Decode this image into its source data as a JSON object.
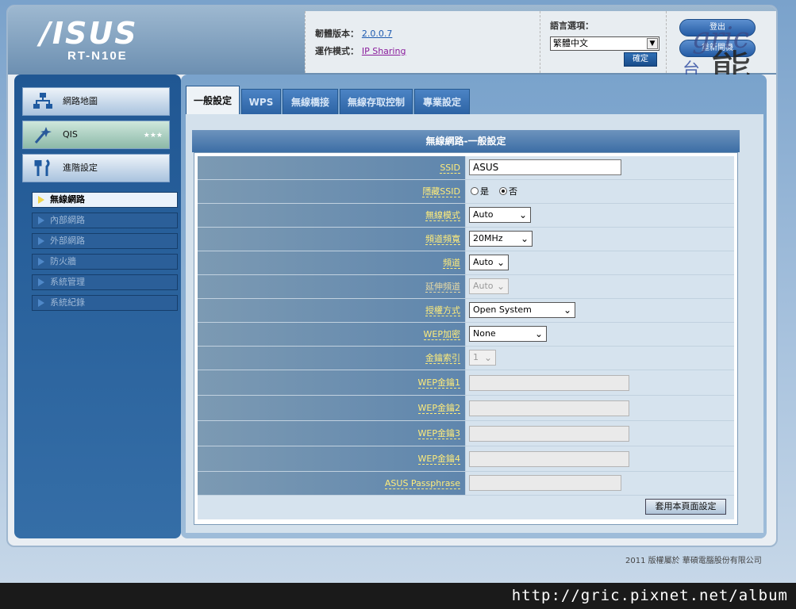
{
  "header": {
    "logo": "/ISUS",
    "model": "RT-N10E",
    "firmware_label": "韌體版本：",
    "firmware_value": "2.0.0.7",
    "mode_label": "運作模式：",
    "mode_value": "IP Sharing",
    "lang_label": "語言選項：",
    "lang_value": "繁體中文",
    "confirm_label": "確定",
    "logout_label": "登出",
    "reboot_label": "重新開機"
  },
  "watermark": {
    "latin": "gric",
    "cjk_small": "台灣",
    "cjk_big": "熊"
  },
  "sidebar": {
    "main": [
      {
        "label": "網路地圖",
        "icon": "network-map-icon"
      },
      {
        "label": "QIS",
        "icon": "wand-icon"
      },
      {
        "label": "進階設定",
        "icon": "tools-icon"
      }
    ],
    "sub": [
      "無線網路",
      "內部網路",
      "外部網路",
      "防火牆",
      "系統管理",
      "系統紀錄"
    ]
  },
  "tabs": [
    "一般設定",
    "WPS",
    "無線橋接",
    "無線存取控制",
    "專業設定"
  ],
  "form": {
    "title": "無線網路-一般設定",
    "rows": [
      {
        "label": "SSID",
        "value": "ASUS"
      },
      {
        "label": "隱藏SSID",
        "opt_yes": "是",
        "opt_no": "否"
      },
      {
        "label": "無線模式",
        "value": "Auto"
      },
      {
        "label": "頻道頻寬",
        "value": "20MHz"
      },
      {
        "label": "頻道",
        "value": "Auto"
      },
      {
        "label": "延伸頻道",
        "value": "Auto"
      },
      {
        "label": "授權方式",
        "value": "Open System"
      },
      {
        "label": "WEP加密",
        "value": "None"
      },
      {
        "label": "金鑰索引",
        "value": "1"
      },
      {
        "label": "WEP金鑰1",
        "value": ""
      },
      {
        "label": "WEP金鑰2",
        "value": ""
      },
      {
        "label": "WEP金鑰3",
        "value": ""
      },
      {
        "label": "WEP金鑰4",
        "value": ""
      },
      {
        "label": "ASUS Passphrase",
        "value": ""
      }
    ],
    "apply_label": "套用本頁面設定"
  },
  "copyright": "2011 版權屬於 華碩電腦股份有限公司",
  "footer_url": "http://gric.pixnet.net/album"
}
